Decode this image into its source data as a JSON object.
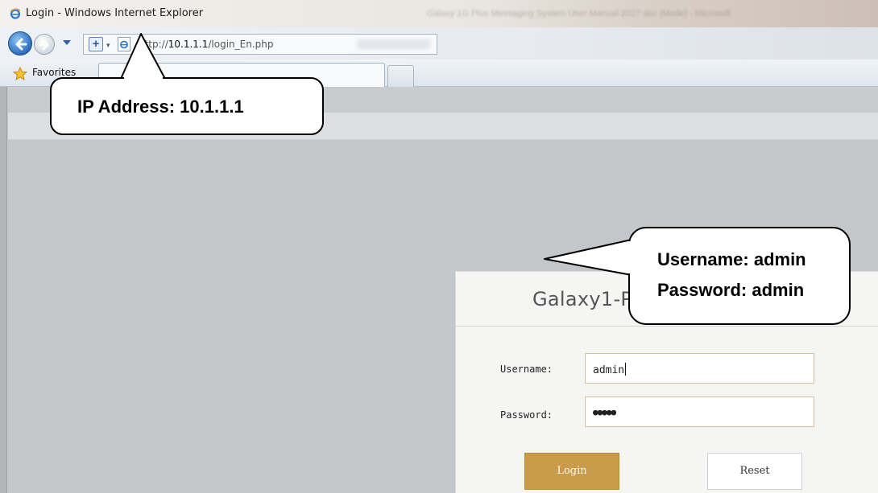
{
  "browser": {
    "window_title": "Login - Windows Internet Explorer",
    "background_title_blurred": "Galaxy 1G Plus Messaging System User Manual 2027.doc [Mode] - Microsoft",
    "url_prefix": "http://",
    "url_host": "10.1.1.1",
    "url_path": "/login_En.php",
    "favorites_label": "Favorites"
  },
  "login": {
    "title": "Galaxy1-P",
    "username_label": "Username:",
    "username_value": "admin",
    "password_label": "Password:",
    "password_mask": "●●●●●",
    "login_button": "Login",
    "reset_button": "Reset"
  },
  "annotations": {
    "ip_callout": "IP Address: 10.1.1.1",
    "credentials_line1": "Username: admin",
    "credentials_line2": "Password: admin"
  },
  "colors": {
    "login_button": "#c99b4a",
    "page_background": "#c4c7ca",
    "input_border": "#d9c196"
  }
}
